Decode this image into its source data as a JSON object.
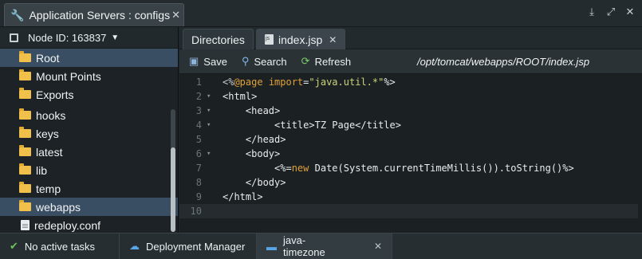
{
  "window": {
    "tab_title": "Application Servers : configs",
    "controls": [
      "download-icon",
      "expand-icon",
      "close-icon"
    ]
  },
  "left": {
    "node_label": "Node ID: 163837",
    "tree": [
      {
        "label": "Root",
        "icon": "folder",
        "selected": true
      },
      {
        "label": "Mount Points",
        "icon": "folder",
        "selected": false
      },
      {
        "label": "Exports",
        "icon": "folder-share",
        "selected": false
      },
      {
        "label": "hooks",
        "icon": "folder",
        "selected": false
      },
      {
        "label": "keys",
        "icon": "folder",
        "selected": false
      },
      {
        "label": "latest",
        "icon": "folder",
        "selected": false
      },
      {
        "label": "lib",
        "icon": "folder",
        "selected": false
      },
      {
        "label": "temp",
        "icon": "folder",
        "selected": false
      },
      {
        "label": "webapps",
        "icon": "folder",
        "selected": true
      },
      {
        "label": "redeploy.conf",
        "icon": "file",
        "selected": false
      }
    ]
  },
  "editor_tabs": [
    {
      "label": "Directories",
      "active": false
    },
    {
      "label": "index.jsp",
      "active": true
    }
  ],
  "toolbar": {
    "save": "Save",
    "search": "Search",
    "refresh": "Refresh",
    "path": "/opt/tomcat/webapps/ROOT/index.jsp"
  },
  "code_lines": [
    {
      "n": "1",
      "fold": "",
      "text": "<%@page import=\"java.util.*\"%>"
    },
    {
      "n": "2",
      "fold": "▾",
      "text": "<html>"
    },
    {
      "n": "3",
      "fold": "▾",
      "text": "    <head>"
    },
    {
      "n": "4",
      "fold": "▾",
      "text": "         <title>TZ Page</title>"
    },
    {
      "n": "5",
      "fold": "",
      "text": "    </head>"
    },
    {
      "n": "6",
      "fold": "▾",
      "text": "    <body>"
    },
    {
      "n": "7",
      "fold": "",
      "text": "         <%=new Date(System.currentTimeMillis()).toString()%>"
    },
    {
      "n": "8",
      "fold": "",
      "text": "    </body>"
    },
    {
      "n": "9",
      "fold": "",
      "text": "</html>"
    },
    {
      "n": "10",
      "fold": "",
      "text": ""
    }
  ],
  "status": {
    "tasks": "No active tasks",
    "deployment": "Deployment Manager",
    "env": "java-timezone"
  }
}
